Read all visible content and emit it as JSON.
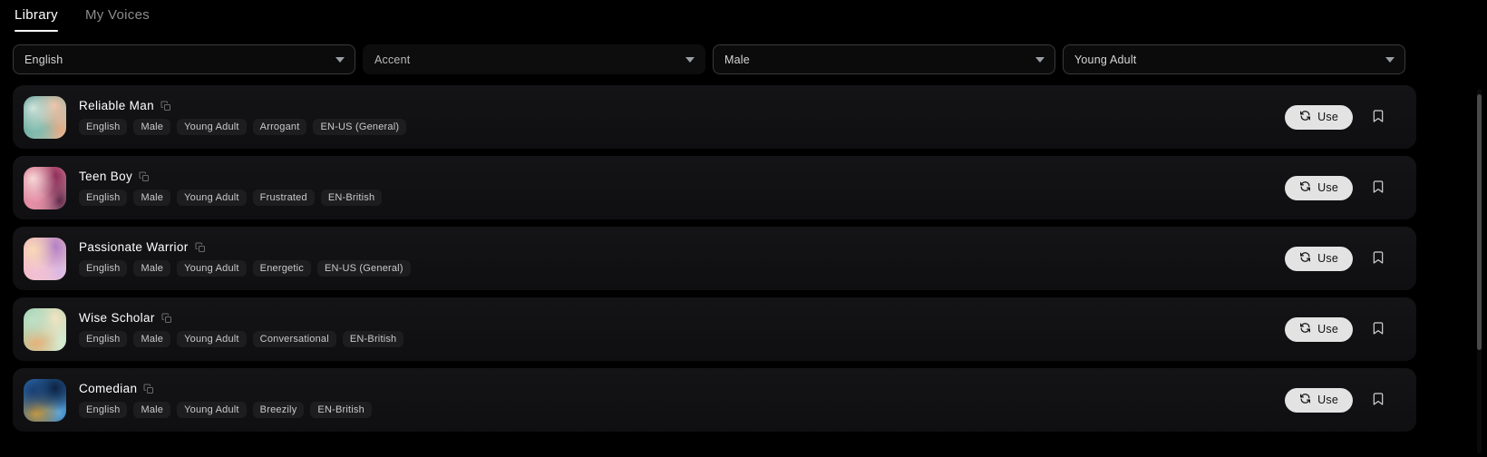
{
  "tabs": [
    {
      "label": "Library",
      "active": true
    },
    {
      "label": "My Voices",
      "active": false
    }
  ],
  "filters": [
    {
      "name": "language",
      "value": "English",
      "placeholder": "Language",
      "is_placeholder": false,
      "bordered": true
    },
    {
      "name": "accent",
      "value": "Accent",
      "placeholder": "Accent",
      "is_placeholder": true,
      "bordered": false
    },
    {
      "name": "gender",
      "value": "Male",
      "placeholder": "Gender",
      "is_placeholder": false,
      "bordered": true
    },
    {
      "name": "age",
      "value": "Young Adult",
      "placeholder": "Age",
      "is_placeholder": false,
      "bordered": true
    }
  ],
  "actions": {
    "use_label": "Use",
    "use_icon": "refresh-icon",
    "bookmark_icon": "bookmark-icon",
    "copy_icon": "copy-icon"
  },
  "voices": [
    {
      "name": "Reliable Man",
      "tags": [
        "English",
        "Male",
        "Young Adult",
        "Arrogant",
        "EN-US (General)"
      ],
      "avatar_colors": [
        "#cfe6dd",
        "#1f6b62",
        "#f2c3a7",
        "#7fbdb0",
        "#e8a982"
      ]
    },
    {
      "name": "Teen Boy",
      "tags": [
        "English",
        "Male",
        "Young Adult",
        "Frustrated",
        "EN-British"
      ],
      "avatar_colors": [
        "#f6d8d8",
        "#c43a62",
        "#8b2a57",
        "#e88fa8",
        "#5c2346"
      ]
    },
    {
      "name": "Passionate Warrior",
      "tags": [
        "English",
        "Male",
        "Young Adult",
        "Energetic",
        "EN-US (General)"
      ],
      "avatar_colors": [
        "#f7d9b8",
        "#e7a0c4",
        "#b07ec8",
        "#f3c0d6",
        "#d8b6e8"
      ]
    },
    {
      "name": "Wise Scholar",
      "tags": [
        "English",
        "Male",
        "Young Adult",
        "Conversational",
        "EN-British"
      ],
      "avatar_colors": [
        "#bfe0c6",
        "#8fc9a8",
        "#f6e3c0",
        "#e9b077",
        "#d8ecd2"
      ]
    },
    {
      "name": "Comedian",
      "tags": [
        "English",
        "Male",
        "Young Adult",
        "Breezily",
        "EN-British"
      ],
      "avatar_colors": [
        "#1b3f72",
        "#2f7fc4",
        "#0d2240",
        "#c79a3e",
        "#5aa6dd"
      ]
    }
  ],
  "colors": {
    "page_background": "#000000",
    "card_background": "#141416",
    "tag_background": "#1d1d20",
    "accent_text": "#ffffff",
    "muted_text": "#8c8c8c",
    "use_button_background": "#e3e3e3",
    "scrollbar_thumb": "#4a4a4a"
  },
  "scrollbar": {
    "name": "voice-list-scrollbar"
  }
}
